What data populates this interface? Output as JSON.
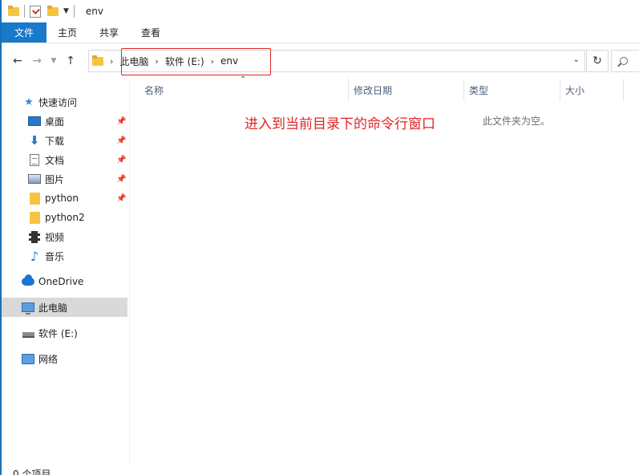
{
  "window": {
    "title": "env"
  },
  "ribbon": {
    "tabs": [
      "文件",
      "主页",
      "共享",
      "查看"
    ]
  },
  "address": {
    "crumbs": [
      "此电脑",
      "软件 (E:)",
      "env"
    ]
  },
  "columns": [
    "名称",
    "修改日期",
    "类型",
    "大小"
  ],
  "sidebar": {
    "items": [
      {
        "label": "快速访问",
        "icon": "star-icon"
      },
      {
        "label": "桌面",
        "icon": "desktop-icon",
        "pinned": true
      },
      {
        "label": "下载",
        "icon": "download-icon",
        "pinned": true
      },
      {
        "label": "文档",
        "icon": "document-icon",
        "pinned": true
      },
      {
        "label": "图片",
        "icon": "pictures-icon",
        "pinned": true
      },
      {
        "label": "python",
        "icon": "folder-icon",
        "pinned": true
      },
      {
        "label": "python2",
        "icon": "folder-icon"
      },
      {
        "label": "视频",
        "icon": "video-icon"
      },
      {
        "label": "音乐",
        "icon": "music-icon"
      },
      {
        "label": "OneDrive",
        "icon": "onedrive-icon"
      },
      {
        "label": "此电脑",
        "icon": "this-pc-icon",
        "selected": true
      },
      {
        "label": "软件 (E:)",
        "icon": "drive-icon"
      },
      {
        "label": "网络",
        "icon": "network-icon"
      }
    ]
  },
  "content": {
    "empty_message": "此文件夹为空。"
  },
  "annotation": {
    "text": "进入到当前目录下的命令行窗口"
  },
  "status": {
    "item_count": "0 个项目"
  },
  "colors": {
    "accent": "#1979ca",
    "annotation": "#e02424"
  }
}
